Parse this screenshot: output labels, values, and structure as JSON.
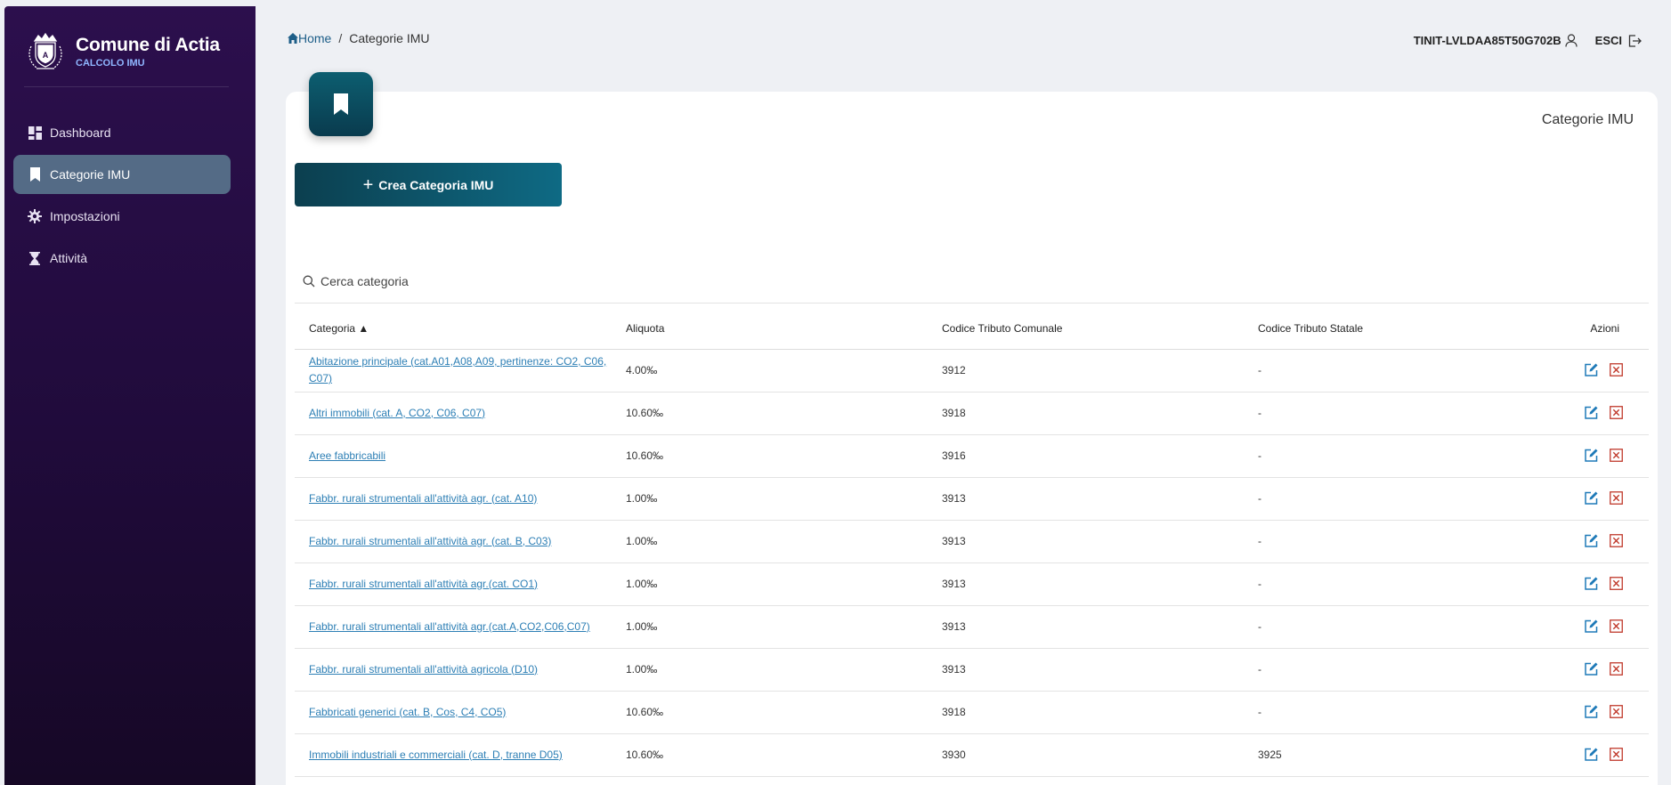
{
  "brand": {
    "name": "Comune di Actia",
    "subtitle": "CALCOLO IMU"
  },
  "sidebar": {
    "items": [
      {
        "label": "Dashboard",
        "icon": "dashboard-icon",
        "active": false
      },
      {
        "label": "Categorie IMU",
        "icon": "bookmark-icon",
        "active": true
      },
      {
        "label": "Impostazioni",
        "icon": "gear-icon",
        "active": false
      },
      {
        "label": "Attività",
        "icon": "hourglass-icon",
        "active": false
      }
    ]
  },
  "breadcrumb": {
    "home": "Home",
    "separator": "/",
    "current": "Categorie IMU"
  },
  "user": {
    "id": "TINIT-LVLDAA85T50G702B",
    "logout": "ESCI"
  },
  "card": {
    "title": "Categorie IMU",
    "create_label": "Crea Categoria IMU"
  },
  "search": {
    "placeholder": "Cerca categoria"
  },
  "table": {
    "headers": [
      "Categoria ▲",
      "Aliquota",
      "Codice Tributo Comunale",
      "Codice Tributo Statale",
      "Azioni"
    ],
    "rows": [
      [
        "Abitazione principale (cat.A01,A08,A09, pertinenze: CO2, C06, C07)",
        "4.00‰",
        "3912",
        "-"
      ],
      [
        "Altri immobili (cat. A, CO2, C06, C07)",
        "10.60‰",
        "3918",
        "-"
      ],
      [
        "Aree fabbricabili",
        "10.60‰",
        "3916",
        "-"
      ],
      [
        "Fabbr. rurali strumentali all'attività agr. (cat. A10)",
        "1.00‰",
        "3913",
        "-"
      ],
      [
        "Fabbr. rurali strumentali all'attività agr. (cat. B, C03)",
        "1.00‰",
        "3913",
        "-"
      ],
      [
        "Fabbr. rurali strumentali all'attività agr.(cat. CO1)",
        "1.00‰",
        "3913",
        "-"
      ],
      [
        "Fabbr. rurali strumentali all'attività agr.(cat.A,CO2,C06,C07)",
        "1.00‰",
        "3913",
        "-"
      ],
      [
        "Fabbr. rurali strumentali all'attività agricola (D10)",
        "1.00‰",
        "3913",
        "-"
      ],
      [
        "Fabbricati generici (cat. B, Cos, C4, CO5)",
        "10.60‰",
        "3918",
        "-"
      ],
      [
        "Immobili industriali e commerciali (cat. D, tranne D05)",
        "10.60‰",
        "3930",
        "3925"
      ]
    ]
  },
  "colors": {
    "sidebar": "#2c0f4d",
    "accent": "#0e6a84",
    "link": "#2d7fb5",
    "edit": "#1f7ab8",
    "delete": "#c0392b"
  }
}
